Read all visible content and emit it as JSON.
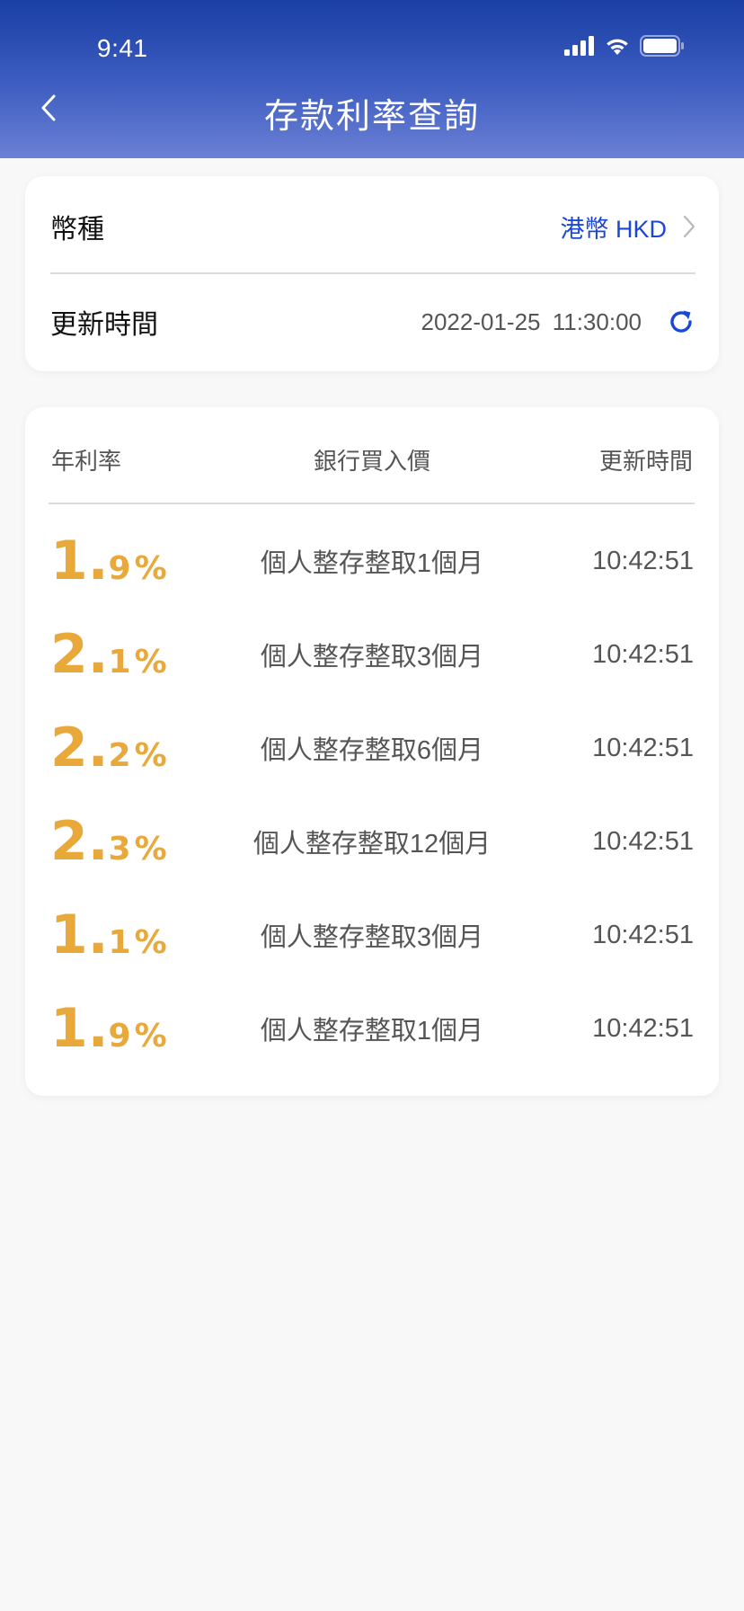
{
  "status_bar": {
    "time": "9:41"
  },
  "nav": {
    "title": "存款利率查詢"
  },
  "filter": {
    "currency_label": "幣種",
    "currency_value": "港幣 HKD",
    "update_label": "更新時間",
    "update_value": "2022-01-25  11:30:00"
  },
  "table": {
    "headers": [
      "年利率",
      "銀行買入價",
      "更新時間"
    ],
    "rows": [
      {
        "rate_int": "1",
        "rate_dec": "9",
        "product": "個人整存整取1個月",
        "time": "10:42:51"
      },
      {
        "rate_int": "2",
        "rate_dec": "1",
        "product": "個人整存整取3個月",
        "time": "10:42:51"
      },
      {
        "rate_int": "2",
        "rate_dec": "2",
        "product": "個人整存整取6個月",
        "time": "10:42:51"
      },
      {
        "rate_int": "2",
        "rate_dec": "3",
        "product": "個人整存整取12個月",
        "time": "10:42:51"
      },
      {
        "rate_int": "1",
        "rate_dec": "1",
        "product": "個人整存整取3個月",
        "time": "10:42:51"
      },
      {
        "rate_int": "1",
        "rate_dec": "9",
        "product": "個人整存整取1個月",
        "time": "10:42:51"
      }
    ]
  },
  "colors": {
    "accent": "#1a47d6",
    "rate": "#e8a93a",
    "header_top": "#1a3fa4",
    "header_bottom": "#6a80d4"
  },
  "icons": [
    "signal-icon",
    "wifi-icon",
    "battery-icon",
    "back-arrow-icon",
    "chevron-right-icon",
    "refresh-icon"
  ]
}
